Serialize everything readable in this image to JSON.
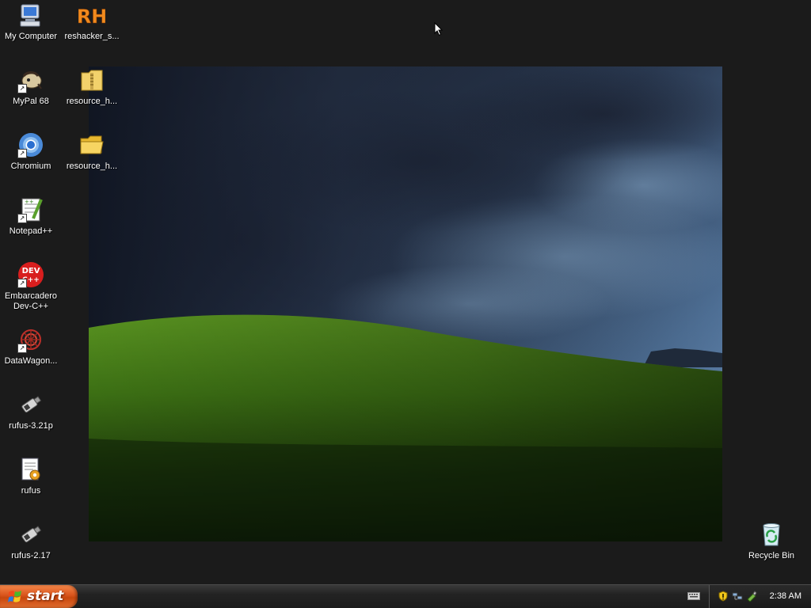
{
  "desktop": {
    "icons": [
      {
        "label": "My Computer",
        "icon": "my-computer-icon",
        "shortcut": false
      },
      {
        "label": "reshacker_s...",
        "icon": "reshacker-icon",
        "shortcut": false
      },
      {
        "label": "MyPal 68",
        "icon": "mypal-icon",
        "shortcut": true
      },
      {
        "label": "resource_h...",
        "icon": "zip-folder-icon",
        "shortcut": false
      },
      {
        "label": "Chromium",
        "icon": "chromium-icon",
        "shortcut": true
      },
      {
        "label": "resource_h...",
        "icon": "folder-icon",
        "shortcut": false
      },
      {
        "label": "Notepad++",
        "icon": "notepadpp-icon",
        "shortcut": true
      },
      {
        "label": "Embarcadero Dev-C++",
        "icon": "devcpp-icon",
        "shortcut": true
      },
      {
        "label": "DataWagon...",
        "icon": "datawagon-icon",
        "shortcut": true
      },
      {
        "label": "rufus-3.21p",
        "icon": "usb-drive-icon",
        "shortcut": false
      },
      {
        "label": "rufus",
        "icon": "config-file-icon",
        "shortcut": false
      },
      {
        "label": "rufus-2.17",
        "icon": "usb-drive-icon",
        "shortcut": false
      },
      {
        "label": "Recycle Bin",
        "icon": "recycle-bin-icon",
        "shortcut": false
      }
    ],
    "reshacker_glyph": "RH",
    "devcpp_glyph_top": "DEV",
    "devcpp_glyph_bottom": "C++"
  },
  "taskbar": {
    "start_label": "start",
    "clock": "2:38 AM",
    "tray_icons": [
      "security-shield-icon",
      "network-icon",
      "safely-remove-icon"
    ]
  },
  "colors": {
    "background": "#1b1b1b",
    "start_button": "#d8541c",
    "taskbar": "#232323"
  }
}
